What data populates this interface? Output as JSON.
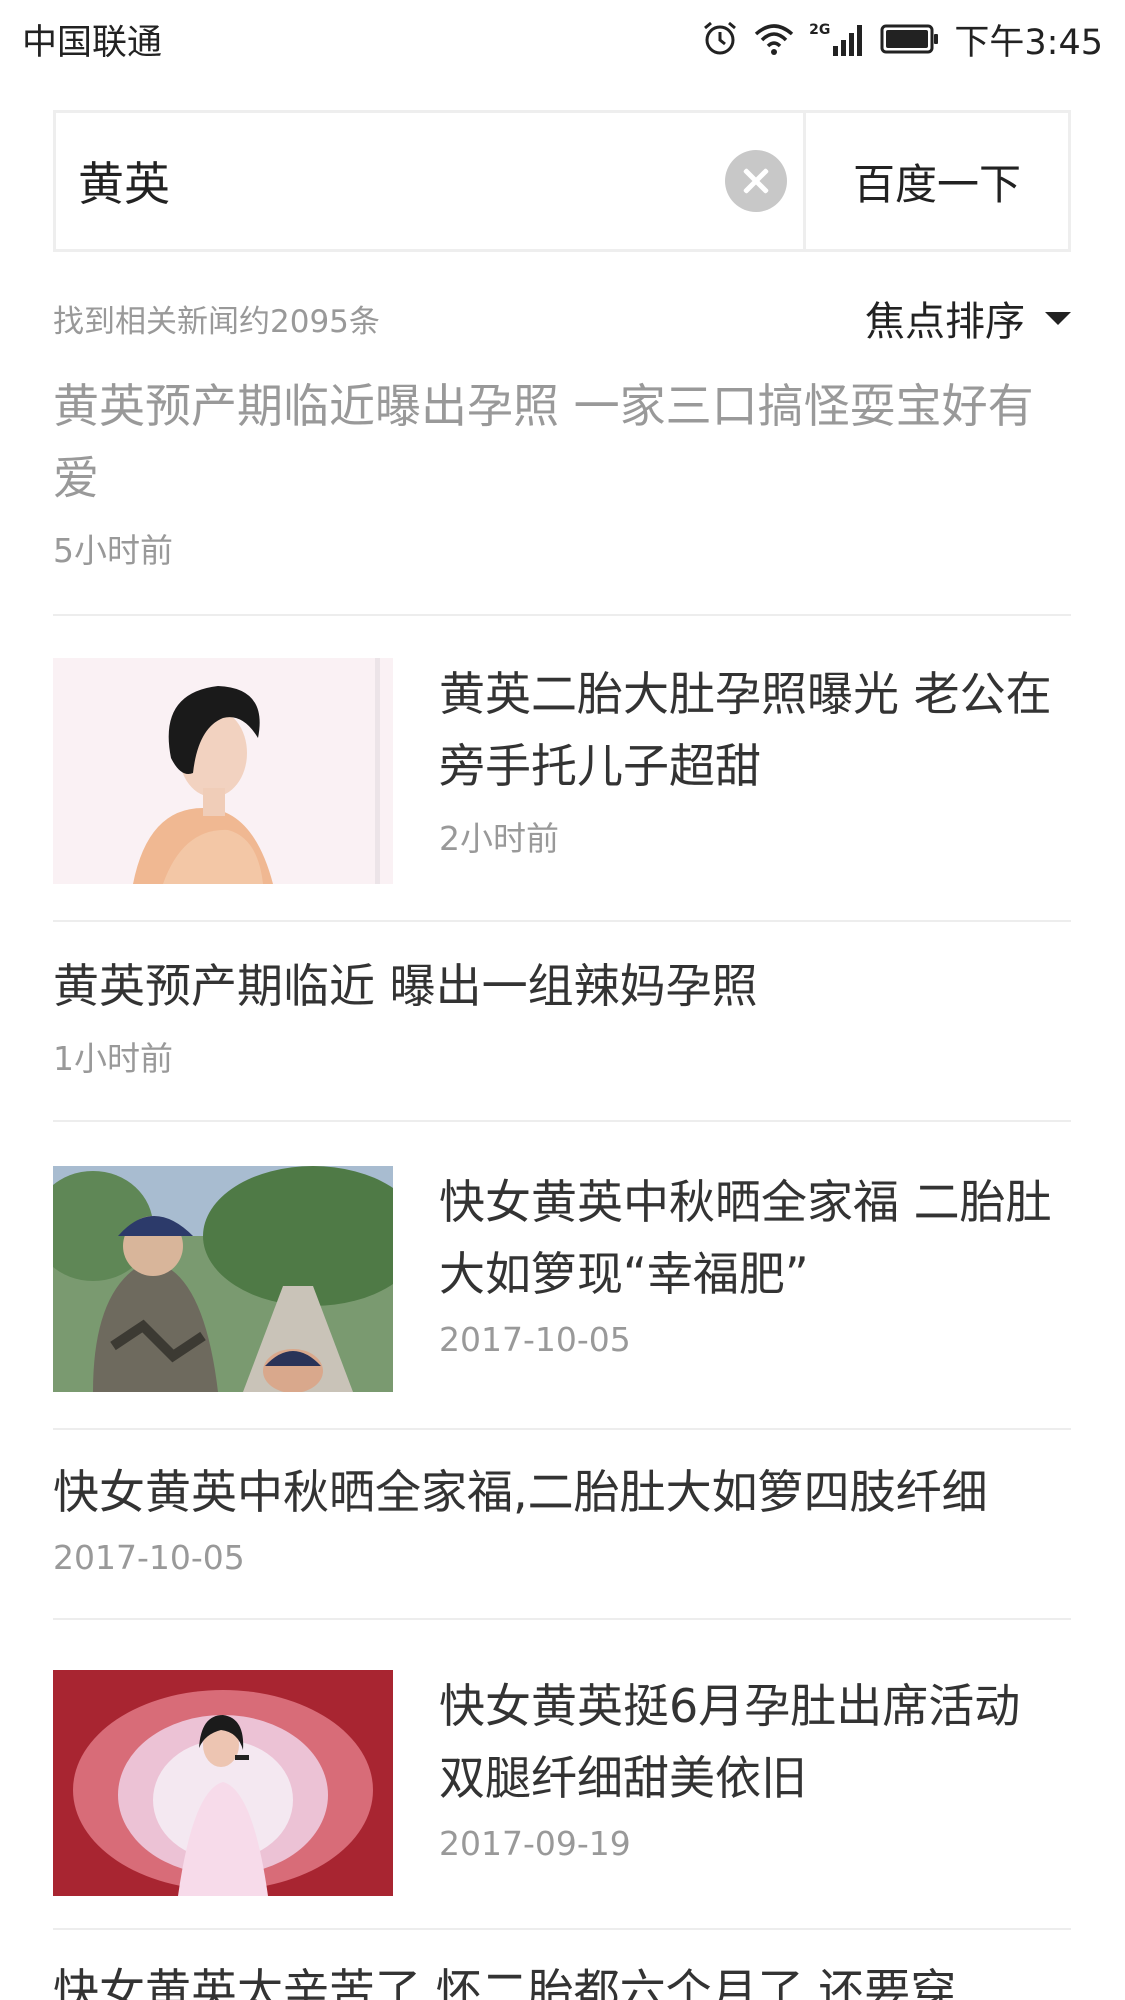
{
  "status_bar": {
    "carrier": "中国联通",
    "network": "2G",
    "time": "下午3:45"
  },
  "search": {
    "query": "黄英",
    "submit_label": "百度一下"
  },
  "results_meta": {
    "count_text": "找到相关新闻约2095条",
    "sort_label": "焦点排序"
  },
  "news": [
    {
      "title": "黄英预产期临近曝出孕照 一家三口搞怪耍宝好有爱",
      "time": "5小时前",
      "visited": true
    },
    {
      "title": "黄英二胎大肚孕照曝光 老公在旁手托儿子超甜",
      "time": "2小时前",
      "thumbnail": "woman-portrait-thumbnail"
    },
    {
      "title": "黄英预产期临近 曝出一组辣妈孕照",
      "time": "1小时前"
    },
    {
      "title": "快女黄英中秋晒全家福 二胎肚大如箩现“幸福肥”",
      "time": "2017-10-05",
      "thumbnail": "family-outdoor-thumbnail"
    },
    {
      "title": "快女黄英中秋晒全家福,二胎肚大如箩四肢纤细",
      "time": "2017-10-05"
    },
    {
      "title": "快女黄英挺6月孕肚出席活动 双腿纤细甜美依旧",
      "time": "2017-09-19",
      "thumbnail": "stage-singer-thumbnail"
    },
    {
      "title": "快女黄英太辛苦了 怀二胎都六个月了 还要穿"
    }
  ]
}
